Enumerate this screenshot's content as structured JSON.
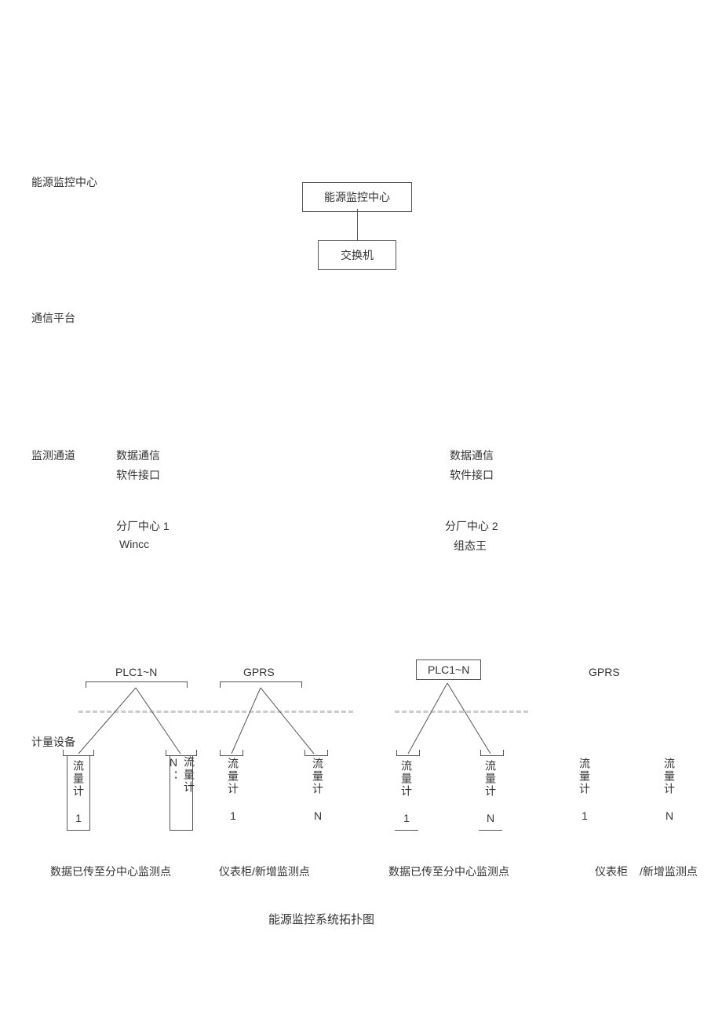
{
  "sections": {
    "center_label": "能源监控中心",
    "comm_platform_label": "通信平台",
    "monitor_channel_label": "监测通道",
    "metering_equip_label": "计量设备"
  },
  "top": {
    "center_box": "能源监控中心",
    "switch_box": "交换机"
  },
  "channel": {
    "data_comm": "数据通信",
    "software_if": "软件接口"
  },
  "branches": {
    "b1": {
      "center": "分厂中心 1",
      "software": "Wincc"
    },
    "b2": {
      "center": "分厂中心 2",
      "software": "组态王"
    }
  },
  "nodes": {
    "plc": "PLC1~N",
    "gprs": "GPRS"
  },
  "meters": {
    "m1": "流量计 1",
    "mn": "流量计 N",
    "mn_colon": "流量计 N："
  },
  "bottom": {
    "uploaded": "数据已传至分中心监测点",
    "cabinet_new": "仪表柜/新增监测点",
    "cabinet": "仪表柜",
    "new_point": "/新增监测点"
  },
  "title": "能源监控系统拓扑图"
}
